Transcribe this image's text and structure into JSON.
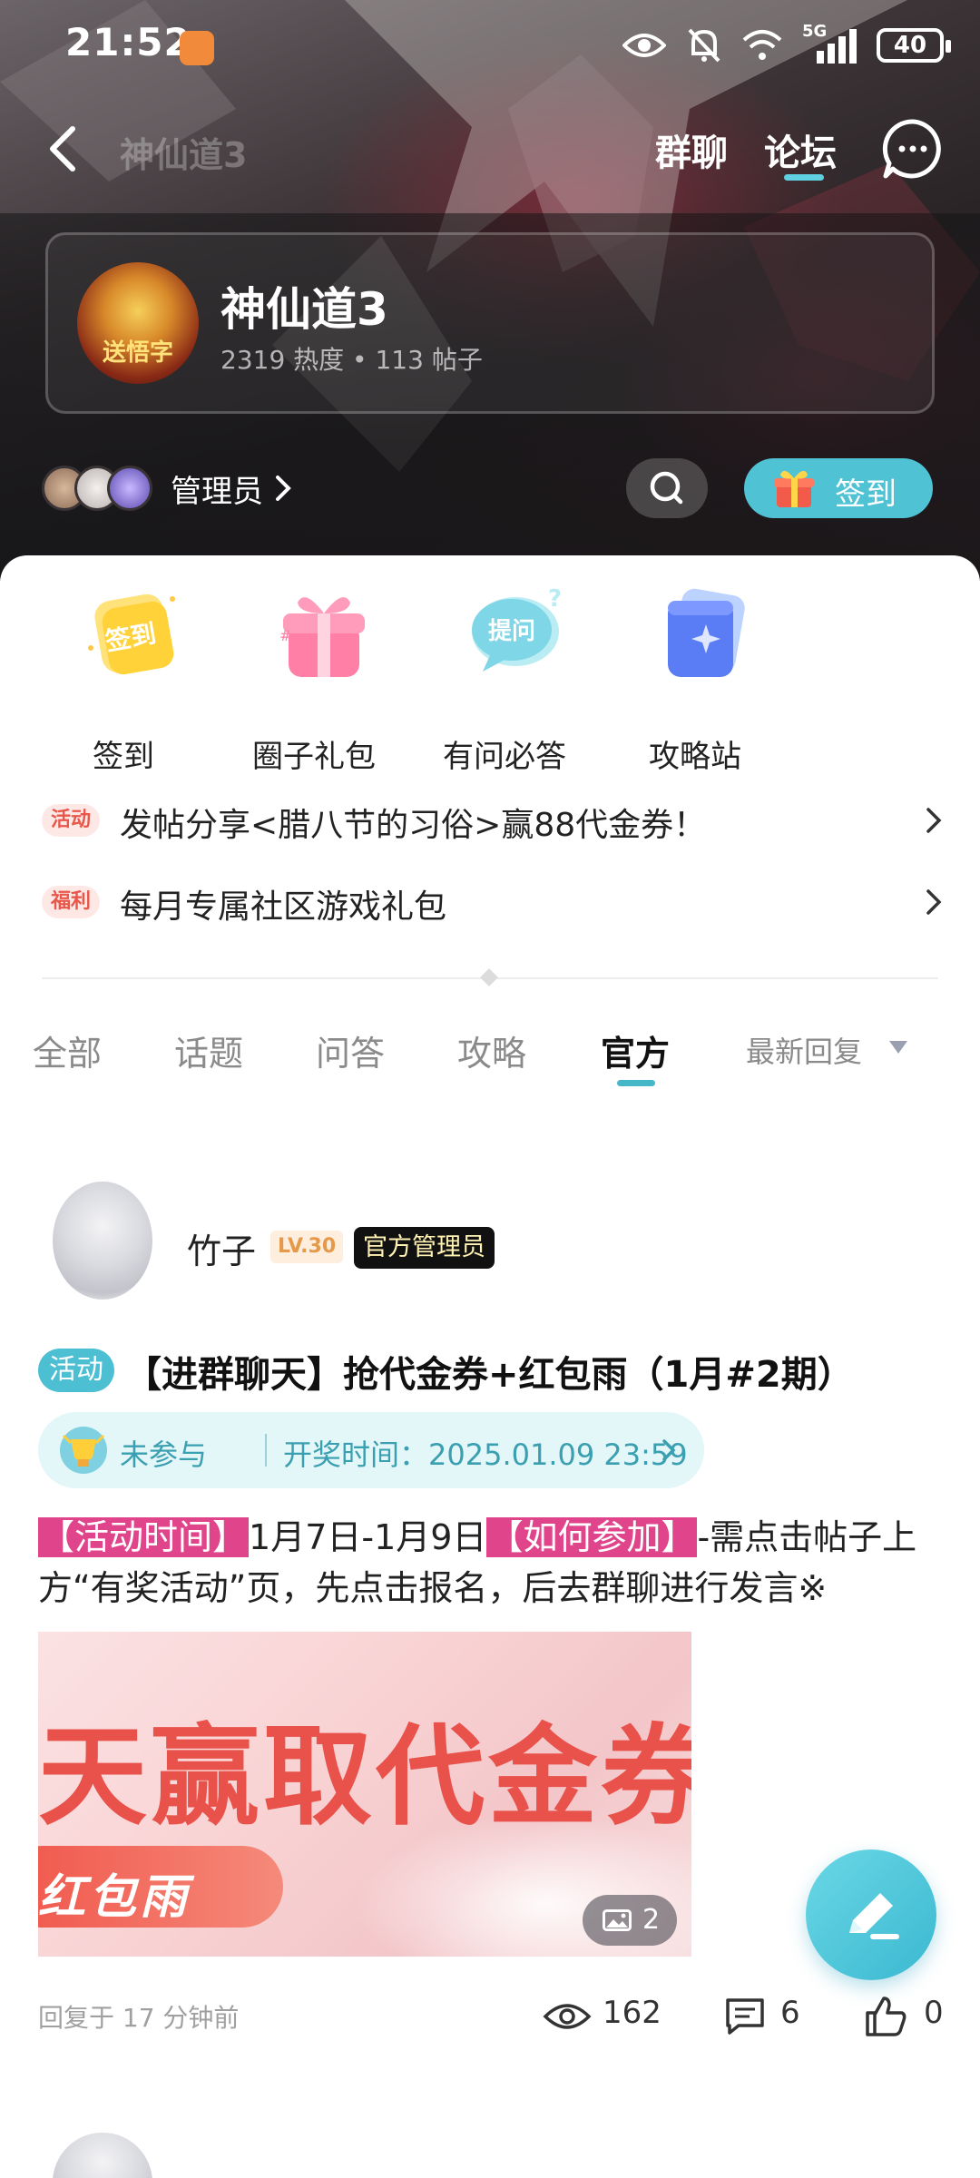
{
  "status_bar": {
    "time": "21:52",
    "network": "5G",
    "battery": "40"
  },
  "nav": {
    "title": "神仙道3",
    "tab_chat": "群聊",
    "tab_forum": "论坛"
  },
  "forum": {
    "name": "神仙道3",
    "avatar_text": "送悟字",
    "stats": "2319 热度 • 113 帖子",
    "admin_label": "管理员",
    "signin_label": "签到"
  },
  "quick_actions": [
    {
      "label": "签到",
      "icon": "sign-in-card-icon",
      "icon_text": "签到"
    },
    {
      "label": "圈子礼包",
      "icon": "gift-box-icon"
    },
    {
      "label": "有问必答",
      "icon": "question-bubble-icon",
      "icon_text": "提问"
    },
    {
      "label": "攻略站",
      "icon": "guide-card-icon"
    }
  ],
  "notices": [
    {
      "tag": "活动",
      "text": "发帖分享<腊八节的习俗>赢88代金券！"
    },
    {
      "tag": "福利",
      "text": "每月专属社区游戏礼包"
    }
  ],
  "filter_tabs": [
    {
      "label": "全部",
      "active": false
    },
    {
      "label": "话题",
      "active": false
    },
    {
      "label": "问答",
      "active": false
    },
    {
      "label": "攻略",
      "active": false
    },
    {
      "label": "官方",
      "active": true
    }
  ],
  "sort_label": "最新回复",
  "post": {
    "author": "竹子",
    "level": "LV.30",
    "role_badge": "官方管理员",
    "tag": "活动",
    "title": "【进群聊天】抢代金券+红包雨（1月#2期）",
    "status": "未参与",
    "draw_time": "开奖时间：2025.01.09  23:59",
    "body_hl1": "【活动时间】",
    "body_t1": "1月7日-1月9日",
    "body_hl2": "【如何参加】",
    "body_t2": "-需点击帖子上方“有奖活动”页，先点击报名，后去群聊进行发言※",
    "image_text_big": "天赢取代金券",
    "image_text_pill": "红包雨",
    "image_count": "2",
    "reply_time": "回复于 17 分钟前",
    "views": "162",
    "comments": "6",
    "likes": "0"
  },
  "colors": {
    "accent": "#4fc2d4",
    "highlight": "#e0458c",
    "tag_red": "#e8574a"
  }
}
